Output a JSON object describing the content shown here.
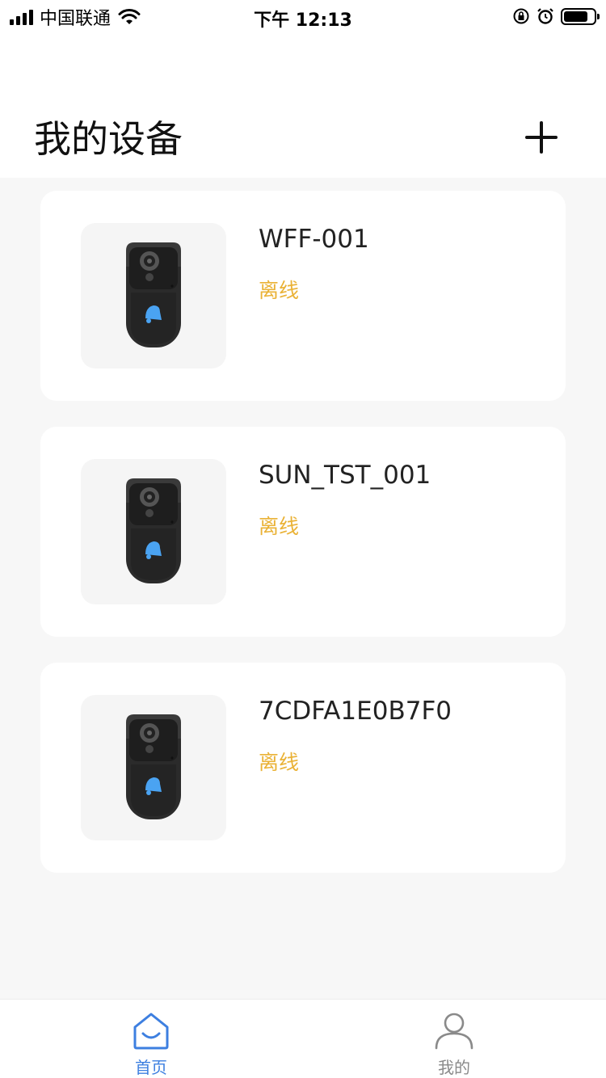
{
  "status_bar": {
    "carrier": "中国联通",
    "time": "下午 12:13"
  },
  "header": {
    "title": "我的设备",
    "add_icon": "plus-icon"
  },
  "devices": [
    {
      "name": "WFF-001",
      "status": "离线",
      "image": "doorbell-icon"
    },
    {
      "name": "SUN_TST_001",
      "status": "离线",
      "image": "doorbell-icon"
    },
    {
      "name": "7CDFA1E0B7F0",
      "status": "离线",
      "image": "doorbell-icon"
    }
  ],
  "tabbar": {
    "home_label": "首页",
    "me_label": "我的",
    "home_icon": "home-icon",
    "me_icon": "user-icon"
  },
  "colors": {
    "status_offline": "#eab236",
    "tab_active": "#3d7fe0",
    "tab_inactive": "#8a8a8a"
  }
}
